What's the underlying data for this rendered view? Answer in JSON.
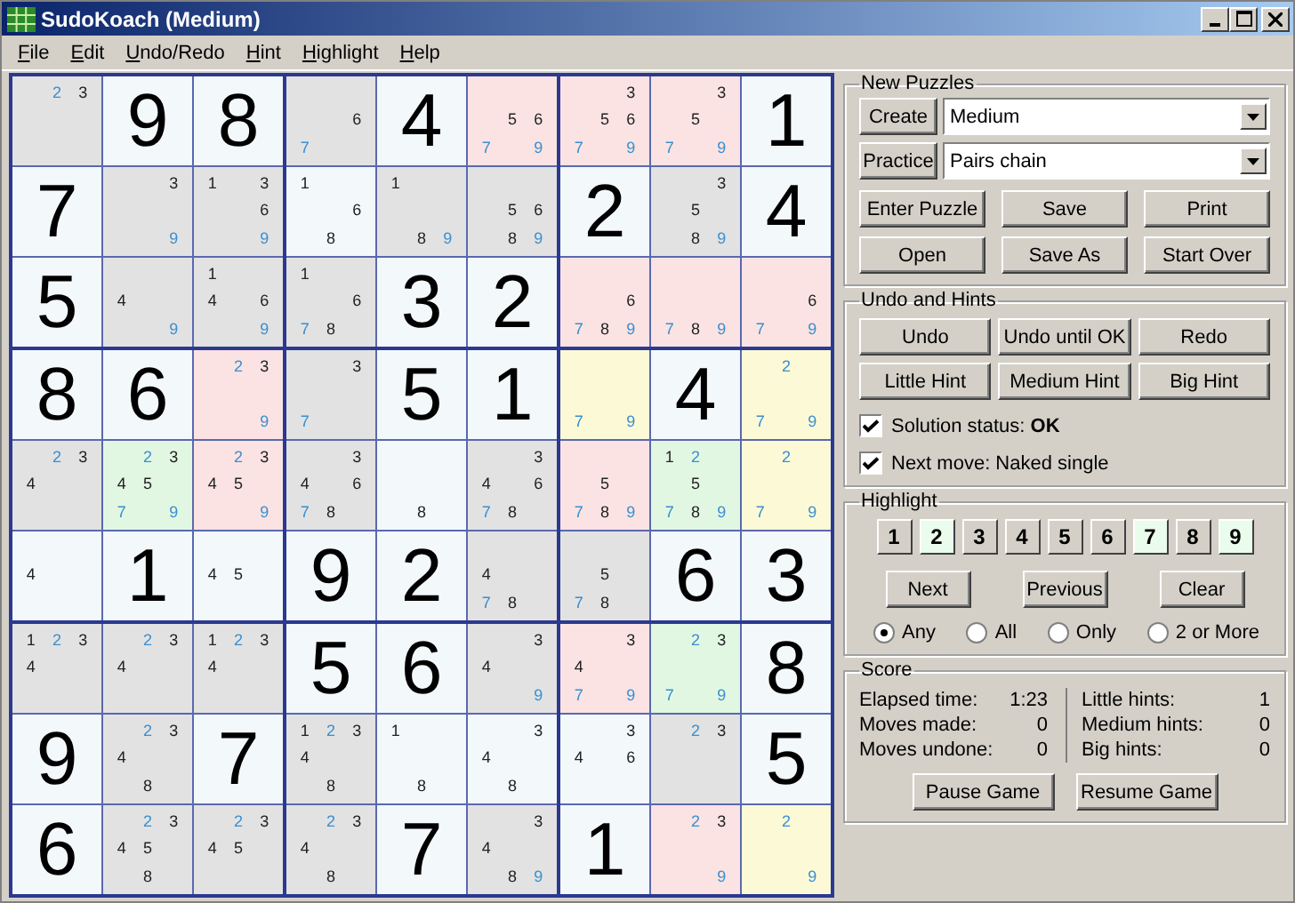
{
  "window": {
    "title": "SudoKoach (Medium)"
  },
  "menu": [
    {
      "label": "File"
    },
    {
      "label": "Edit"
    },
    {
      "label": "Undo/Redo"
    },
    {
      "label": "Hint"
    },
    {
      "label": "Highlight"
    },
    {
      "label": "Help"
    }
  ],
  "grid": {
    "rows": [
      [
        {
          "candidates": [
            "2",
            "3"
          ],
          "color": "#e2e2e2"
        },
        {
          "value": "9",
          "color": "#f3f9fb"
        },
        {
          "value": "8",
          "color": "#f3f9fb"
        },
        {
          "candidates": [
            "6",
            "7"
          ],
          "color": "#e2e2e2"
        },
        {
          "value": "4",
          "color": "#f3f9fb"
        },
        {
          "candidates": [
            "5",
            "6",
            "7",
            "9"
          ],
          "color": "#fbe3e3"
        },
        {
          "candidates": [
            "3",
            "5",
            "6",
            "7",
            "9"
          ],
          "color": "#fbe3e3"
        },
        {
          "candidates": [
            "3",
            "5",
            "7",
            "9"
          ],
          "color": "#fbe3e3"
        },
        {
          "value": "1",
          "color": "#f3f9fb"
        }
      ],
      [
        {
          "value": "7",
          "color": "#f3f9fb"
        },
        {
          "candidates": [
            "3",
            "9"
          ],
          "color": "#e2e2e2"
        },
        {
          "candidates": [
            "1",
            "3",
            "6",
            "9"
          ],
          "color": "#e2e2e2"
        },
        {
          "candidates": [
            "1",
            "6",
            "8"
          ],
          "color": "#f3f9fb"
        },
        {
          "candidates": [
            "1",
            "8",
            "9"
          ],
          "color": "#e2e2e2"
        },
        {
          "candidates": [
            "5",
            "6",
            "8",
            "9"
          ],
          "color": "#e2e2e2"
        },
        {
          "value": "2",
          "color": "#f3f9fb"
        },
        {
          "candidates": [
            "3",
            "5",
            "8",
            "9"
          ],
          "color": "#e2e2e2"
        },
        {
          "value": "4",
          "color": "#f3f9fb"
        }
      ],
      [
        {
          "value": "5",
          "color": "#f3f9fb"
        },
        {
          "candidates": [
            "4",
            "9"
          ],
          "color": "#e2e2e2"
        },
        {
          "candidates": [
            "1",
            "4",
            "6",
            "9"
          ],
          "color": "#e2e2e2"
        },
        {
          "candidates": [
            "1",
            "6",
            "7",
            "8"
          ],
          "color": "#e2e2e2"
        },
        {
          "value": "3",
          "color": "#f3f9fb"
        },
        {
          "value": "2",
          "color": "#f3f9fb"
        },
        {
          "candidates": [
            "6",
            "7",
            "8",
            "9"
          ],
          "color": "#fbe3e3"
        },
        {
          "candidates": [
            "7",
            "8",
            "9"
          ],
          "color": "#fbe3e3"
        },
        {
          "candidates": [
            "6",
            "7",
            "9"
          ],
          "color": "#fbe3e3"
        }
      ],
      [
        {
          "value": "8",
          "color": "#f3f9fb"
        },
        {
          "value": "6",
          "color": "#f3f9fb"
        },
        {
          "candidates": [
            "2",
            "3",
            "9"
          ],
          "color": "#fbe3e3"
        },
        {
          "candidates": [
            "3",
            "7"
          ],
          "color": "#e2e2e2"
        },
        {
          "value": "5",
          "color": "#f3f9fb"
        },
        {
          "value": "1",
          "color": "#f3f9fb"
        },
        {
          "candidates": [
            "7",
            "9"
          ],
          "color": "#fcfad6"
        },
        {
          "value": "4",
          "color": "#f3f9fb"
        },
        {
          "candidates": [
            "2",
            "7",
            "9"
          ],
          "color": "#fcfad6"
        }
      ],
      [
        {
          "candidates": [
            "2",
            "3",
            "4"
          ],
          "color": "#e2e2e2"
        },
        {
          "candidates": [
            "2",
            "3",
            "4",
            "5",
            "7",
            "9"
          ],
          "color": "#e2f7e2"
        },
        {
          "candidates": [
            "2",
            "3",
            "4",
            "5",
            "9"
          ],
          "color": "#fbe3e3"
        },
        {
          "candidates": [
            "3",
            "4",
            "6",
            "7",
            "8"
          ],
          "color": "#e2e2e2"
        },
        {
          "candidates": [
            "8"
          ],
          "color": "#f3f9fb"
        },
        {
          "candidates": [
            "3",
            "4",
            "6",
            "7",
            "8"
          ],
          "color": "#e2e2e2"
        },
        {
          "candidates": [
            "5",
            "7",
            "8",
            "9"
          ],
          "color": "#fbe3e3"
        },
        {
          "candidates": [
            "1",
            "2",
            "5",
            "7",
            "8",
            "9"
          ],
          "color": "#e2f7e2"
        },
        {
          "candidates": [
            "2",
            "7",
            "9"
          ],
          "color": "#fcfad6"
        }
      ],
      [
        {
          "candidates": [
            "4"
          ],
          "color": "#f3f9fb"
        },
        {
          "value": "1",
          "color": "#f3f9fb"
        },
        {
          "candidates": [
            "4",
            "5"
          ],
          "color": "#f3f9fb"
        },
        {
          "value": "9",
          "color": "#f3f9fb"
        },
        {
          "value": "2",
          "color": "#f3f9fb"
        },
        {
          "candidates": [
            "4",
            "7",
            "8"
          ],
          "color": "#e2e2e2"
        },
        {
          "candidates": [
            "5",
            "7",
            "8"
          ],
          "color": "#e2e2e2"
        },
        {
          "value": "6",
          "color": "#f3f9fb"
        },
        {
          "value": "3",
          "color": "#f3f9fb"
        }
      ],
      [
        {
          "candidates": [
            "1",
            "2",
            "3",
            "4"
          ],
          "color": "#e2e2e2"
        },
        {
          "candidates": [
            "2",
            "3",
            "4"
          ],
          "color": "#e2e2e2"
        },
        {
          "candidates": [
            "1",
            "2",
            "3",
            "4"
          ],
          "color": "#e2e2e2"
        },
        {
          "value": "5",
          "color": "#f3f9fb"
        },
        {
          "value": "6",
          "color": "#f3f9fb"
        },
        {
          "candidates": [
            "3",
            "4",
            "9"
          ],
          "color": "#e2e2e2"
        },
        {
          "candidates": [
            "3",
            "4",
            "7",
            "9"
          ],
          "color": "#fbe3e3"
        },
        {
          "candidates": [
            "2",
            "3",
            "7",
            "9"
          ],
          "color": "#e2f7e2"
        },
        {
          "value": "8",
          "color": "#f3f9fb"
        }
      ],
      [
        {
          "value": "9",
          "color": "#f3f9fb"
        },
        {
          "candidates": [
            "2",
            "3",
            "4",
            "8"
          ],
          "color": "#e2e2e2"
        },
        {
          "value": "7",
          "color": "#f3f9fb"
        },
        {
          "candidates": [
            "1",
            "2",
            "3",
            "4",
            "8"
          ],
          "color": "#e2e2e2"
        },
        {
          "candidates": [
            "1",
            "8"
          ],
          "color": "#f3f9fb"
        },
        {
          "candidates": [
            "3",
            "4",
            "8"
          ],
          "color": "#f3f9fb"
        },
        {
          "candidates": [
            "3",
            "4",
            "6"
          ],
          "color": "#f3f9fb"
        },
        {
          "candidates": [
            "2",
            "3"
          ],
          "color": "#e2e2e2"
        },
        {
          "value": "5",
          "color": "#f3f9fb"
        }
      ],
      [
        {
          "value": "6",
          "color": "#f3f9fb"
        },
        {
          "candidates": [
            "2",
            "3",
            "4",
            "5",
            "8"
          ],
          "color": "#e2e2e2"
        },
        {
          "candidates": [
            "2",
            "3",
            "4",
            "5"
          ],
          "color": "#e2e2e2"
        },
        {
          "candidates": [
            "2",
            "3",
            "4",
            "8"
          ],
          "color": "#e2e2e2"
        },
        {
          "value": "7",
          "color": "#f3f9fb"
        },
        {
          "candidates": [
            "3",
            "4",
            "8",
            "9"
          ],
          "color": "#e2e2e2"
        },
        {
          "value": "1",
          "color": "#f3f9fb"
        },
        {
          "candidates": [
            "2",
            "3",
            "9"
          ],
          "color": "#fbe3e3"
        },
        {
          "candidates": [
            "2",
            "9"
          ],
          "color": "#fcfad6"
        }
      ]
    ]
  },
  "new_puzzles": {
    "title": "New Puzzles",
    "create_button": "Create",
    "difficulty": "Medium",
    "practice_button": "Practice",
    "technique": "Pairs chain",
    "buttons": [
      "Enter Puzzle",
      "Save",
      "Print",
      "Open",
      "Save As",
      "Start Over"
    ]
  },
  "undo_hints": {
    "title": "Undo and Hints",
    "buttons": [
      "Undo",
      "Undo until OK",
      "Redo",
      "Little Hint",
      "Medium Hint",
      "Big Hint"
    ],
    "options": [
      {
        "label": "Solution status:  **OK**",
        "checked": true
      },
      {
        "label": "Next move:  Naked single",
        "checked": true
      }
    ]
  },
  "highlight": {
    "title": "Highlight",
    "digits": [
      {
        "label": "1",
        "selected": false
      },
      {
        "label": "2",
        "selected": true
      },
      {
        "label": "3",
        "selected": false
      },
      {
        "label": "4",
        "selected": false
      },
      {
        "label": "5",
        "selected": false
      },
      {
        "label": "6",
        "selected": false
      },
      {
        "label": "7",
        "selected": true
      },
      {
        "label": "8",
        "selected": false
      },
      {
        "label": "9",
        "selected": true
      }
    ],
    "buttons": [
      "Next",
      "Previous",
      "Clear"
    ],
    "modes": [
      {
        "label": "Any",
        "selected": true
      },
      {
        "label": "All",
        "selected": false
      },
      {
        "label": "Only",
        "selected": false
      },
      {
        "label": "2 or More",
        "selected": false
      }
    ]
  },
  "score": {
    "title": "Score",
    "left": [
      {
        "label": "Elapsed time:",
        "value": "1:23"
      },
      {
        "label": "Moves made:",
        "value": "0"
      },
      {
        "label": "Moves undone:",
        "value": "0"
      }
    ],
    "right": [
      {
        "label": "Little hints:",
        "value": "1"
      },
      {
        "label": "Medium hints:",
        "value": "0"
      },
      {
        "label": "Big hints:",
        "value": "0"
      }
    ],
    "buttons": [
      "Pause Game",
      "Resume Game"
    ]
  }
}
